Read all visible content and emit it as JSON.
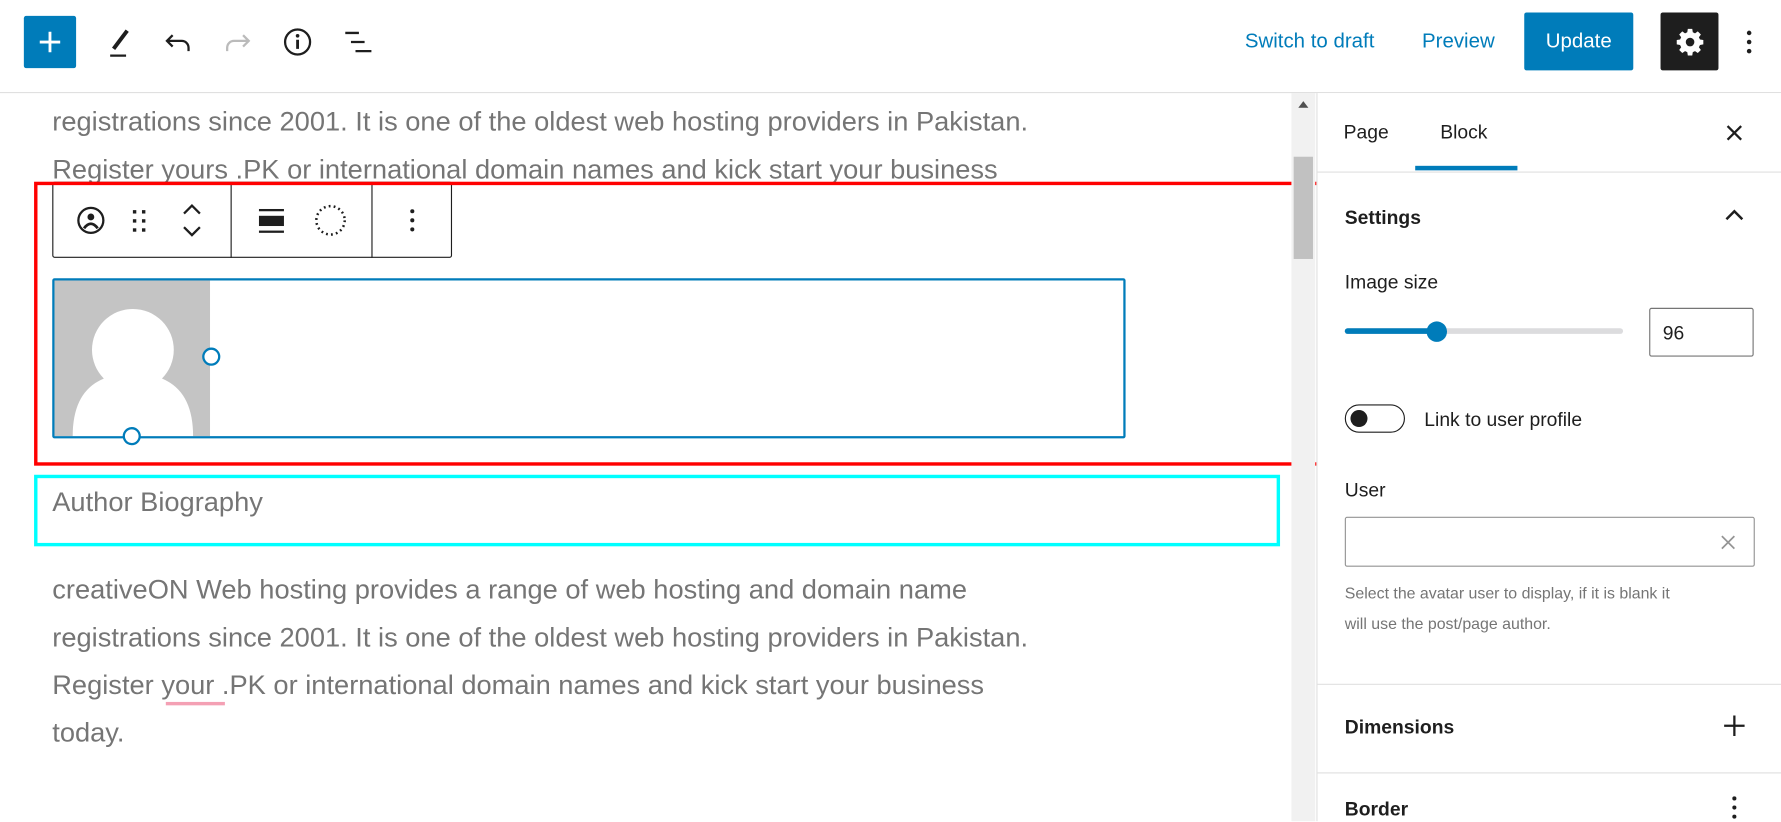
{
  "header": {
    "icons": [
      "plus-icon",
      "pencil-icon",
      "undo-icon",
      "redo-icon",
      "info-icon",
      "list-view-icon",
      "gear-icon",
      "more-vertical-icon"
    ],
    "switch_to_draft": "Switch to draft",
    "preview": "Preview",
    "update": "Update"
  },
  "editor": {
    "top_lines": [
      "registrations since 2001. It is one of the oldest web hosting providers in Pakistan.",
      "Register yours .PK or international domain names and kick start your business"
    ],
    "toolbar_icons": [
      "avatar-icon",
      "drag-handle-icon",
      "move-up-icon",
      "move-down-icon",
      "align-icon",
      "border-radius-icon",
      "more-vertical-icon"
    ],
    "heading": "Author Biography",
    "paragraph_lines": [
      "creativeON Web hosting provides a range of web hosting and domain name",
      "registrations since 2001. It is one of the oldest web hosting providers in Pakistan.",
      "Register your .PK or international domain names and kick start your business",
      "today."
    ]
  },
  "sidebar": {
    "tabs": [
      "Page",
      "Block"
    ],
    "active_tab": "Block",
    "settings_title": "Settings",
    "image_size_label": "Image size",
    "image_size_value": "96",
    "slider_fraction": 0.33,
    "link_label": "Link to user profile",
    "link_enabled": false,
    "user_label": "User",
    "user_value": "",
    "help_lines": [
      "Select the avatar user to display, if it is blank it",
      "will use the post/page author."
    ],
    "dimensions": "Dimensions",
    "border": "Border"
  },
  "colors": {
    "accent": "#007cba",
    "highlight_red": "#ff0000",
    "highlight_cyan": "#00ffff"
  }
}
